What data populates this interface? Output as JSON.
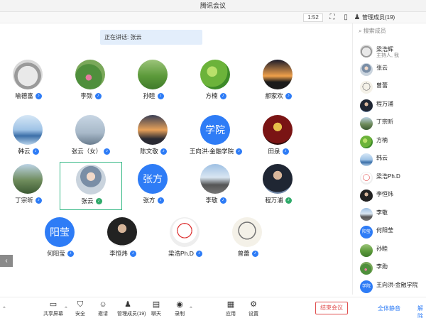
{
  "window": {
    "title": "腾讯会议"
  },
  "topbar": {
    "zoom": "1:52",
    "members_count": "管理成员(19)"
  },
  "speaking": {
    "label": "正在讲话: 张云"
  },
  "tiles": [
    {
      "name": "喻德富",
      "avatar": "photo-cat",
      "mic": "blue"
    },
    {
      "name": "李勋",
      "avatar": "photo-lotus",
      "mic": "blue"
    },
    {
      "name": "孙睦",
      "avatar": "photo-field",
      "mic": "blue"
    },
    {
      "name": "方楠",
      "avatar": "photo-green",
      "mic": "blue"
    },
    {
      "name": "郝家欢",
      "avatar": "photo-sunset",
      "mic": "blue"
    },
    {
      "name": "韩云",
      "avatar": "photo-lake",
      "mic": "blue"
    },
    {
      "name": "张云（女）",
      "avatar": "photo-sky",
      "mic": "blue"
    },
    {
      "name": "陈文敬",
      "avatar": "photo-dusk",
      "mic": "blue"
    },
    {
      "name": "王向洪-金融学院",
      "avatar": "text",
      "avatar_text": "学院",
      "mic": "blue"
    },
    {
      "name": "田泉",
      "avatar": "photo-muai",
      "mic": "blue"
    },
    {
      "name": "丁宗昕",
      "avatar": "photo-hills",
      "mic": "blue"
    },
    {
      "name": "张云",
      "avatar": "photo-girl",
      "mic": "green",
      "active": true
    },
    {
      "name": "张方",
      "avatar": "text",
      "avatar_text": "张方",
      "mic": "blue"
    },
    {
      "name": "李敬",
      "avatar": "photo-road",
      "mic": "blue"
    },
    {
      "name": "程万浦",
      "avatar": "photo-suit",
      "mic": "green"
    },
    {
      "name": "何阳莹",
      "avatar": "text",
      "avatar_text": "阳莹",
      "mic": "blue"
    },
    {
      "name": "李恒炜",
      "avatar": "photo-man",
      "mic": "blue"
    },
    {
      "name": "梁浩Ph.D",
      "avatar": "photo-sketch",
      "mic": "blue"
    },
    {
      "name": "曾蕾",
      "avatar": "photo-einstein",
      "mic": "blue"
    }
  ],
  "sidebar": {
    "search_placeholder": "搜索成员",
    "members": [
      {
        "name": "梁浩辉",
        "sub": "主持人, 我",
        "avatar": "photo-cat"
      },
      {
        "name": "张云",
        "sub": "",
        "avatar": "photo-girl"
      },
      {
        "name": "曾蕾",
        "sub": "",
        "avatar": "photo-einstein"
      },
      {
        "name": "程万浦",
        "sub": "",
        "avatar": "photo-suit"
      },
      {
        "name": "丁宗昕",
        "sub": "",
        "avatar": "photo-hills"
      },
      {
        "name": "方楠",
        "sub": "",
        "avatar": "photo-green"
      },
      {
        "name": "韩云",
        "sub": "",
        "avatar": "photo-lake"
      },
      {
        "name": "梁浩Ph.D",
        "sub": "",
        "avatar": "photo-sketch"
      },
      {
        "name": "李恒炜",
        "sub": "",
        "avatar": "photo-man"
      },
      {
        "name": "李敬",
        "sub": "",
        "avatar": "photo-road"
      },
      {
        "name": "何阳莹",
        "sub": "",
        "avatar": "text",
        "avatar_text": "阳莹"
      },
      {
        "name": "孙睦",
        "sub": "",
        "avatar": "photo-field"
      },
      {
        "name": "李勋",
        "sub": "",
        "avatar": "photo-lotus"
      },
      {
        "name": "王向洪-金融学院",
        "sub": "",
        "avatar": "text",
        "avatar_text": "学院"
      }
    ]
  },
  "toolbar": {
    "items": [
      {
        "label": "共享屏幕",
        "icon": "share-screen-icon",
        "glyph": "▭"
      },
      {
        "label": "安全",
        "icon": "shield-icon",
        "glyph": "⛉"
      },
      {
        "label": "邀请",
        "icon": "invite-icon",
        "glyph": "☺"
      },
      {
        "label": "管理成员(19)",
        "icon": "members-icon",
        "glyph": "♟"
      },
      {
        "label": "聊天",
        "icon": "chat-icon",
        "glyph": "▤"
      },
      {
        "label": "录制",
        "icon": "record-icon",
        "glyph": "◉"
      },
      {
        "label": "应用",
        "icon": "apps-icon",
        "glyph": "▦"
      },
      {
        "label": "设置",
        "icon": "gear-icon",
        "glyph": "⚙"
      }
    ],
    "leave_label": "结束会议",
    "mute_all_label": "全体静音",
    "unmute_label": "解除"
  },
  "colors": {
    "accent": "#2e7cf6",
    "active_border": "#37b986",
    "leave": "#e05050"
  }
}
